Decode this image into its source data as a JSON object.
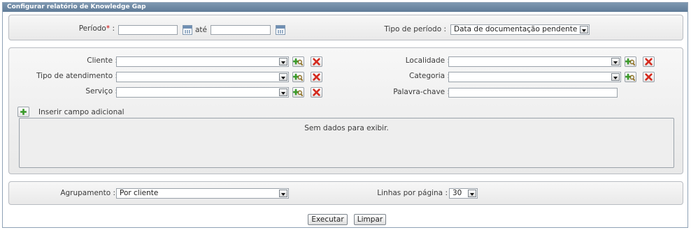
{
  "window": {
    "title": "Configurar relatório de Knowledge Gap"
  },
  "period_panel": {
    "periodo_label": "Período",
    "periodo_required": "*",
    "periodo_suffix": " :",
    "start_value": "",
    "ate_label": "até",
    "end_value": "",
    "tipo_periodo_label": "Tipo de período :",
    "tipo_periodo_value": "Data de documentação pendente"
  },
  "filters_panel": {
    "cliente_label": "Cliente :",
    "cliente_value": "",
    "tipo_atendimento_label": "Tipo de atendimento :",
    "tipo_atendimento_value": "",
    "servico_label": "Serviço :",
    "servico_value": "",
    "localidade_label": "Localidade :",
    "localidade_value": "",
    "categoria_label": "Categoria :",
    "categoria_value": "",
    "palavra_chave_label": "Palavra-chave :",
    "palavra_chave_value": "",
    "inserir_campo_label": "Inserir campo adicional",
    "empty_message": "Sem dados para exibir."
  },
  "grouping_panel": {
    "agrupamento_label": "Agrupamento :",
    "agrupamento_value": "Por cliente",
    "linhas_label": "Linhas por página :",
    "linhas_value": "30"
  },
  "actions": {
    "executar_label": "Executar",
    "limpar_label": "Limpar"
  },
  "icons": {
    "add": "add-green-plus-icon",
    "search_add": "add-search-icon",
    "remove": "red-x-icon",
    "calendar": "calendar-icon"
  },
  "colors": {
    "title_bar": "#6d88a4",
    "required": "#cc0000",
    "add_green": "#3a9a2a",
    "remove_red": "#d42a1e"
  }
}
